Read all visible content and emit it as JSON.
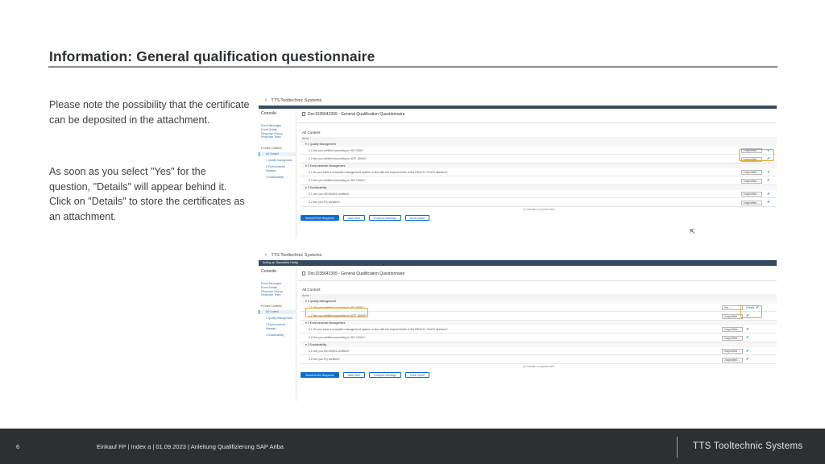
{
  "slide": {
    "title": "Information: General qualification questionnaire",
    "paragraph1": "Please note the possibility that the certificate can be deposited in the attachment.",
    "paragraph2": "As soon as you select \"Yes\" for the question, \"Details\" will appear behind it. Click on \"Details\" to store the certificates as an attachment."
  },
  "screenshot1": {
    "back_glyph": "‹",
    "brand": "TTS Tooltechnic Systems",
    "console_title": "Console",
    "console_links": [
      "Event Messages",
      "Event Details",
      "Response History",
      "Response Team"
    ],
    "console_section": "▾ Event Contents",
    "console_items": [
      "All Content",
      "1  Quality Management",
      "2  Environmental Manage...",
      "3  Sustainability"
    ],
    "doc_title": "Doc1035642309 - General Qualification Questionnaire",
    "all_content": "All Content",
    "name_bar": "Name ↑",
    "sections": [
      {
        "label": "▾  1  Quality Management",
        "questions": [
          {
            "text": "1.1  Are you certified according to ISO 9001?",
            "value": "Unspecified"
          },
          {
            "text": "1.2  Are you certified according to IATF 16949?",
            "value": "Unspecified"
          }
        ]
      },
      {
        "label": "▾  2  Environmental Management",
        "questions": [
          {
            "text": "2.1  Do you have a complete management system in line with the requirements of the REACH / RoHS directive?",
            "value": "Unspecified"
          },
          {
            "text": "2.2  Are you certified according to ISO 14001?",
            "value": "Unspecified"
          }
        ]
      },
      {
        "label": "▾  3  Sustainability",
        "questions": [
          {
            "text": "3.1  Are you ISO 50001 certified?",
            "value": "Unspecified"
          },
          {
            "text": "3.2  Are you PQ certified?",
            "value": "Unspecified"
          }
        ]
      }
    ],
    "hint": "(*) indicates a required field",
    "buttons": [
      "Submit Entire Response",
      "Save draft",
      "Compose Message",
      "Excel Import"
    ]
  },
  "screenshot2": {
    "back_glyph": "‹",
    "brand": "TTS Tooltechnic Systems",
    "dark_bar_text": "Acting as: Samantha Hartig",
    "console_title": "Console",
    "console_links": [
      "Event Messages",
      "Event Details",
      "Response History",
      "Response Team"
    ],
    "console_section": "▾ Event Contents",
    "console_items": [
      "All Content",
      "1  Quality Management",
      "2  Environmental Manage...",
      "3  Sustainability"
    ],
    "doc_title": "Doc1035642309 - General Qualification Questionnaire",
    "all_content": "All Content",
    "name_bar": "Name ↑",
    "sections": [
      {
        "label": "▾  1  Quality Management",
        "questions": [
          {
            "text": "1.1  Are you certified according to ISO 9001?",
            "value": "Yes",
            "details": "Details"
          },
          {
            "text": "1.2  Are you certified according to IATF 16949?",
            "value": "Unspecified"
          }
        ]
      },
      {
        "label": "▾  2  Environmental Management",
        "questions": [
          {
            "text": "2.1  Do you have a complete management system in line with the requirements of the REACH / RoHS directive?",
            "value": "Unspecified"
          },
          {
            "text": "2.2  Are you certified according to ISO 14001?",
            "value": "Unspecified"
          }
        ]
      },
      {
        "label": "▾  3  Sustainability",
        "questions": [
          {
            "text": "3.1  Are you ISO 50001 certified?",
            "value": "Unspecified"
          },
          {
            "text": "3.2  Are you PQ certified?",
            "value": "Unspecified"
          }
        ]
      }
    ],
    "hint": "(*) indicates a required field",
    "buttons": [
      "Submit Entire Response",
      "Save draft",
      "Compose Message",
      "Excel Import"
    ]
  },
  "footer": {
    "page_number": "6",
    "info": "Einkauf FP | Index a | 01.09.2023 | Anleitung Qualifizierung SAP Ariba",
    "brand": "TTS Tooltechnic Systems"
  },
  "colors": {
    "accent_blue": "#0a6ed1",
    "highlight_orange": "#e8a628",
    "footer_bg": "#2d2f32",
    "ariba_shell": "#354a5f"
  }
}
